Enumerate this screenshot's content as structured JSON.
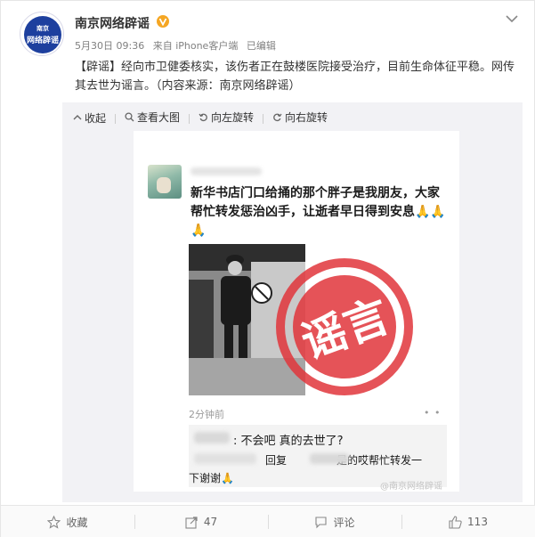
{
  "post": {
    "username": "南京网络辟谣",
    "avatar_text_top": "南京",
    "avatar_text_bottom": "网络辟谣",
    "date": "5月30日 09:36",
    "source": "来自 iPhone客户端",
    "edited": "已编辑",
    "tag": "【辟谣】",
    "body": "经向市卫健委核实，该伤者正在鼓楼医院接受治疗，目前生命体征平稳。网传其去世为谣言。（内容来源：南京网络辟谣）"
  },
  "media_toolbar": {
    "collapse": "收起",
    "view_large": "查看大图",
    "rotate_left": "向左旋转",
    "rotate_right": "向右旋转"
  },
  "screenshot": {
    "message": "新华书店门口给捅的那个胖子是我朋友，大家帮忙转发惩治凶手，让逝者早日得到安息🙏🙏🙏",
    "time_ago": "2分钟前",
    "dots": "• •",
    "reply_1": ": 不会吧 真的去世了?",
    "reply_2_prefix": "回复",
    "reply_2_suffix": "是的哎帮忙转发一",
    "reply_3": "下谢谢🙏",
    "stamp_text": "谣言",
    "stamp_color": "#e0353b",
    "watermark": "@南京网络辟谣"
  },
  "actions": {
    "favorite": "收藏",
    "repost_count": "47",
    "comment": "评论",
    "like_count": "113"
  },
  "colors": {
    "verify_badge": "#f5a623",
    "avatar_bg": "#1d3f9e"
  }
}
